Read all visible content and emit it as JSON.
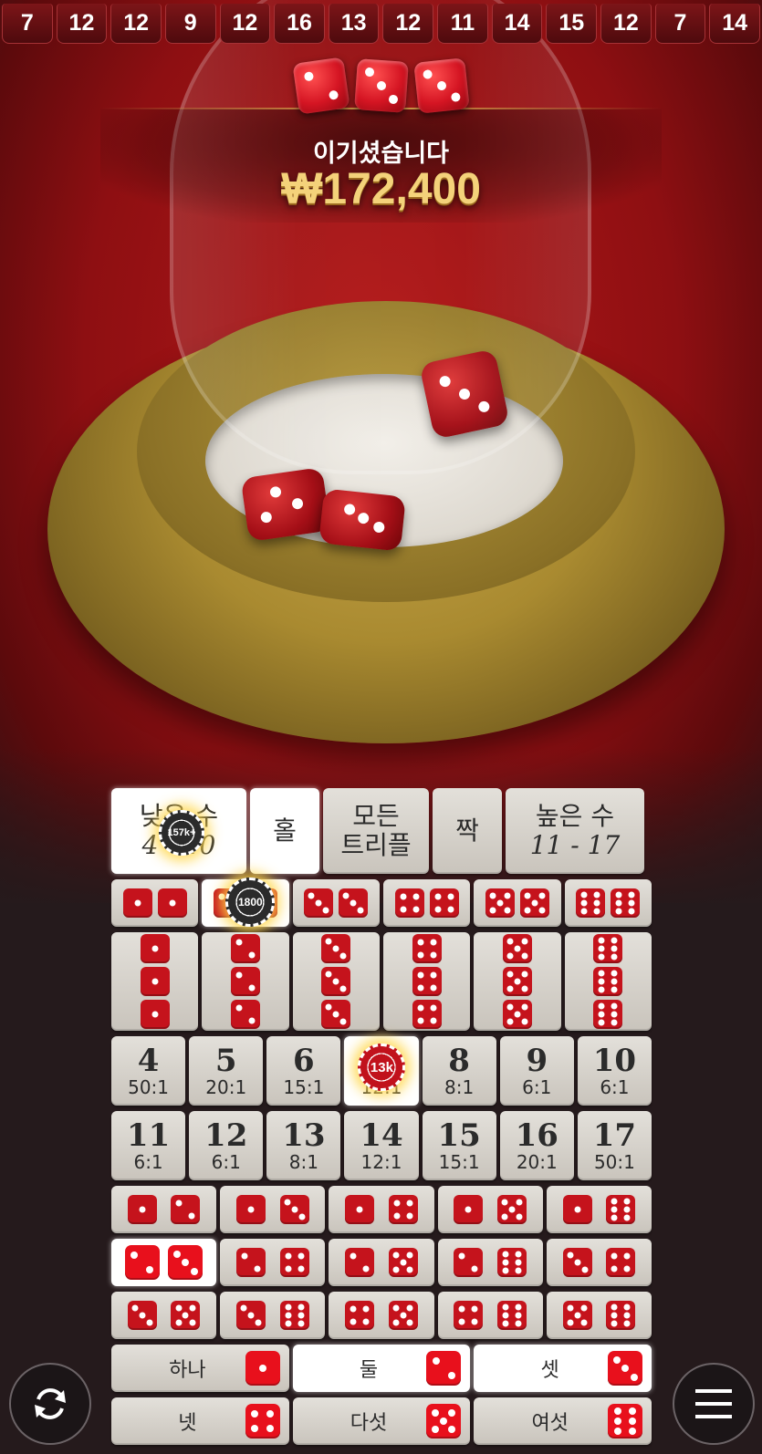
{
  "history": [
    "7",
    "12",
    "12",
    "9",
    "12",
    "16",
    "13",
    "12",
    "11",
    "14",
    "15",
    "12",
    "7",
    "14"
  ],
  "result": {
    "dice": [
      2,
      3,
      3
    ],
    "label": "이기셨습니다",
    "amount": "₩172,400"
  },
  "board": {
    "top": {
      "small": {
        "label": "낮은 수",
        "range": "4 - 10"
      },
      "odd": {
        "label": "홀"
      },
      "any_triple": {
        "label_line1": "모든",
        "label_line2": "트리플"
      },
      "even": {
        "label": "짝"
      },
      "big": {
        "label": "높은 수",
        "range": "11 - 17"
      }
    },
    "pairs": [
      1,
      2,
      3,
      4,
      5,
      6
    ],
    "triples": [
      1,
      2,
      3,
      4,
      5,
      6
    ],
    "totals_row1": [
      {
        "n": "4",
        "odds": "50:1"
      },
      {
        "n": "5",
        "odds": "20:1"
      },
      {
        "n": "6",
        "odds": "15:1"
      },
      {
        "n": "7",
        "odds": "12:1"
      },
      {
        "n": "8",
        "odds": "8:1"
      },
      {
        "n": "9",
        "odds": "6:1"
      },
      {
        "n": "10",
        "odds": "6:1"
      }
    ],
    "totals_row2": [
      {
        "n": "11",
        "odds": "6:1"
      },
      {
        "n": "12",
        "odds": "6:1"
      },
      {
        "n": "13",
        "odds": "8:1"
      },
      {
        "n": "14",
        "odds": "12:1"
      },
      {
        "n": "15",
        "odds": "15:1"
      },
      {
        "n": "16",
        "odds": "20:1"
      },
      {
        "n": "17",
        "odds": "50:1"
      }
    ],
    "combos": [
      [
        [
          1,
          2
        ],
        [
          1,
          3
        ],
        [
          1,
          4
        ],
        [
          1,
          5
        ],
        [
          1,
          6
        ]
      ],
      [
        [
          2,
          3
        ],
        [
          2,
          4
        ],
        [
          2,
          5
        ],
        [
          2,
          6
        ],
        [
          3,
          4
        ]
      ],
      [
        [
          3,
          5
        ],
        [
          3,
          6
        ],
        [
          4,
          5
        ],
        [
          4,
          6
        ],
        [
          5,
          6
        ]
      ]
    ],
    "singles": [
      {
        "label": "하나",
        "face": 1
      },
      {
        "label": "둘",
        "face": 2
      },
      {
        "label": "셋",
        "face": 3
      },
      {
        "label": "넷",
        "face": 4
      },
      {
        "label": "다섯",
        "face": 5
      },
      {
        "label": "여섯",
        "face": 6
      }
    ]
  },
  "chips": {
    "small": "157k+",
    "pair_2": "1800",
    "total_7": "13k"
  },
  "controls": {
    "rebet_icon": "rebet-icon",
    "menu_icon": "menu-icon"
  }
}
